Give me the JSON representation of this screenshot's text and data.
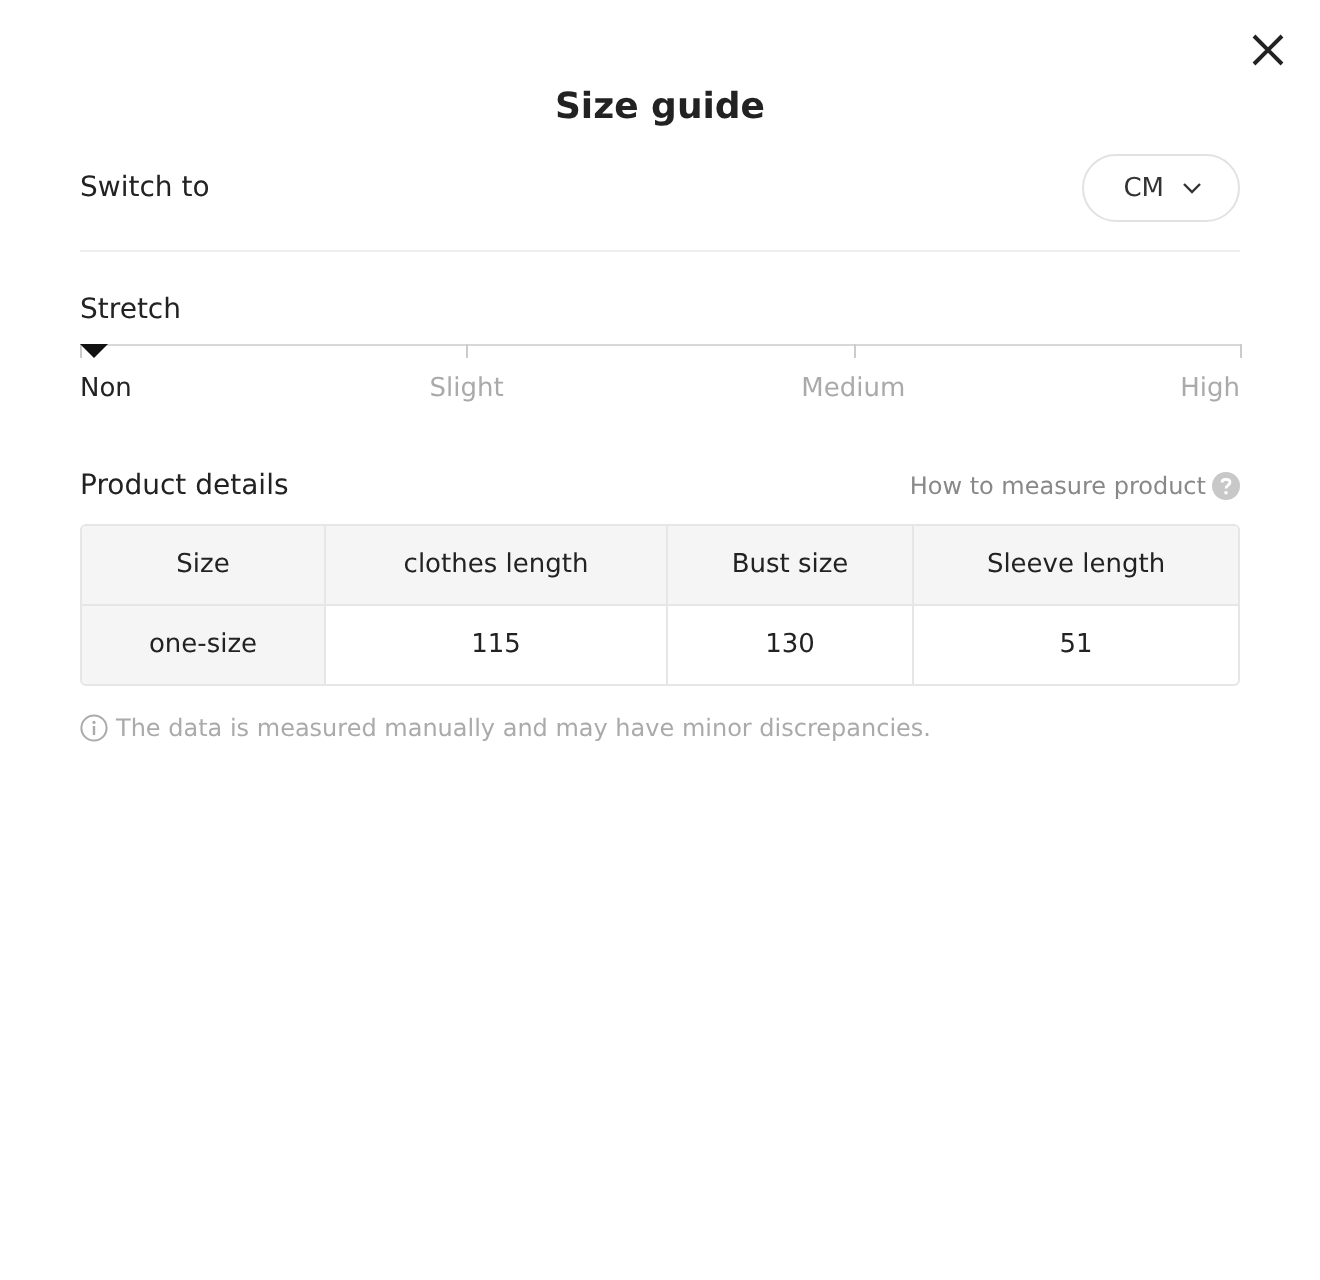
{
  "dialog": {
    "title": "Size guide"
  },
  "unit_switch": {
    "label": "Switch to",
    "value": "CM"
  },
  "stretch": {
    "label": "Stretch",
    "options": [
      {
        "label": "Non",
        "selected": true
      },
      {
        "label": "Slight",
        "selected": false
      },
      {
        "label": "Medium",
        "selected": false
      },
      {
        "label": "High",
        "selected": false
      }
    ]
  },
  "product_details": {
    "title": "Product details",
    "help_link": "How to measure product",
    "table": {
      "columns": [
        "Size",
        "clothes length",
        "Bust size",
        "Sleeve length"
      ],
      "rows": [
        [
          "one-size",
          "115",
          "130",
          "51"
        ]
      ]
    },
    "note": "The data is measured manually and may have minor discrepancies."
  }
}
